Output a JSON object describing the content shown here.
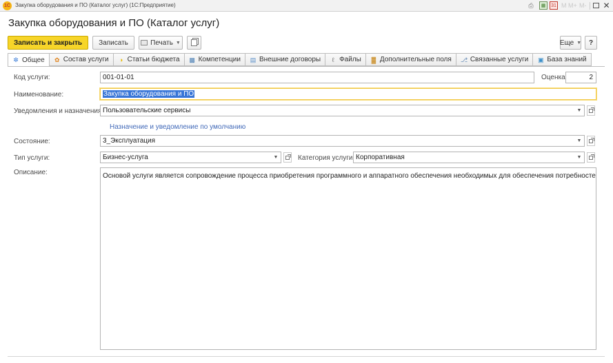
{
  "window": {
    "title": "Закупка оборудования и ПО (Каталог услуг)  (1С:Предприятие)",
    "logo_text": "1С",
    "mem_m": "M",
    "mem_mplus": "M+",
    "mem_mminus": "M-"
  },
  "page": {
    "title": "Закупка оборудования и ПО (Каталог услуг)"
  },
  "toolbar": {
    "save_close_label": "Записать и закрыть",
    "save_label": "Записать",
    "print_label": "Печать",
    "more_label": "Еще",
    "help_label": "?"
  },
  "tabs": [
    {
      "label": "Общее",
      "icon": "general-icon",
      "active": true
    },
    {
      "label": "Состав услуги",
      "icon": "composition-icon"
    },
    {
      "label": "Статьи бюджета",
      "icon": "budget-icon"
    },
    {
      "label": "Компетенции",
      "icon": "competence-icon"
    },
    {
      "label": "Внешние договоры",
      "icon": "contract-icon"
    },
    {
      "label": "Файлы",
      "icon": "paperclip-icon"
    },
    {
      "label": "Дополнительные поля",
      "icon": "chart-icon"
    },
    {
      "label": "Связанные услуги",
      "icon": "link-icon"
    },
    {
      "label": "База знаний",
      "icon": "book-icon"
    }
  ],
  "form": {
    "code_label": "Код услуги:",
    "code_value": "001-01-01",
    "rating_label": "Оценка:",
    "rating_value": "2",
    "name_label": "Наименование:",
    "name_value": "Закупка оборудования и ПО",
    "notifications_label": "Уведомления и назначения:",
    "notifications_value": "Пользовательские сервисы",
    "default_link": "Назначение и уведомление по умолчанию",
    "state_label": "Состояние:",
    "state_value": "3_Эксплуатация",
    "type_label": "Тип услуги:",
    "type_value": "Бизнес-услуга",
    "category_label": "Категория услуги:",
    "category_value": "Корпоративная",
    "description_label": "Описание:",
    "description_value": "Основой услуги является сопровождение процесса приобретения программного и аппаратного обеспечения необходимых для обеспечения потребностей бизнеса."
  },
  "colors": {
    "primary_button": "#f7d529",
    "link": "#4169b8",
    "selection": "#3875d7",
    "focus_border": "#f2c94c"
  }
}
